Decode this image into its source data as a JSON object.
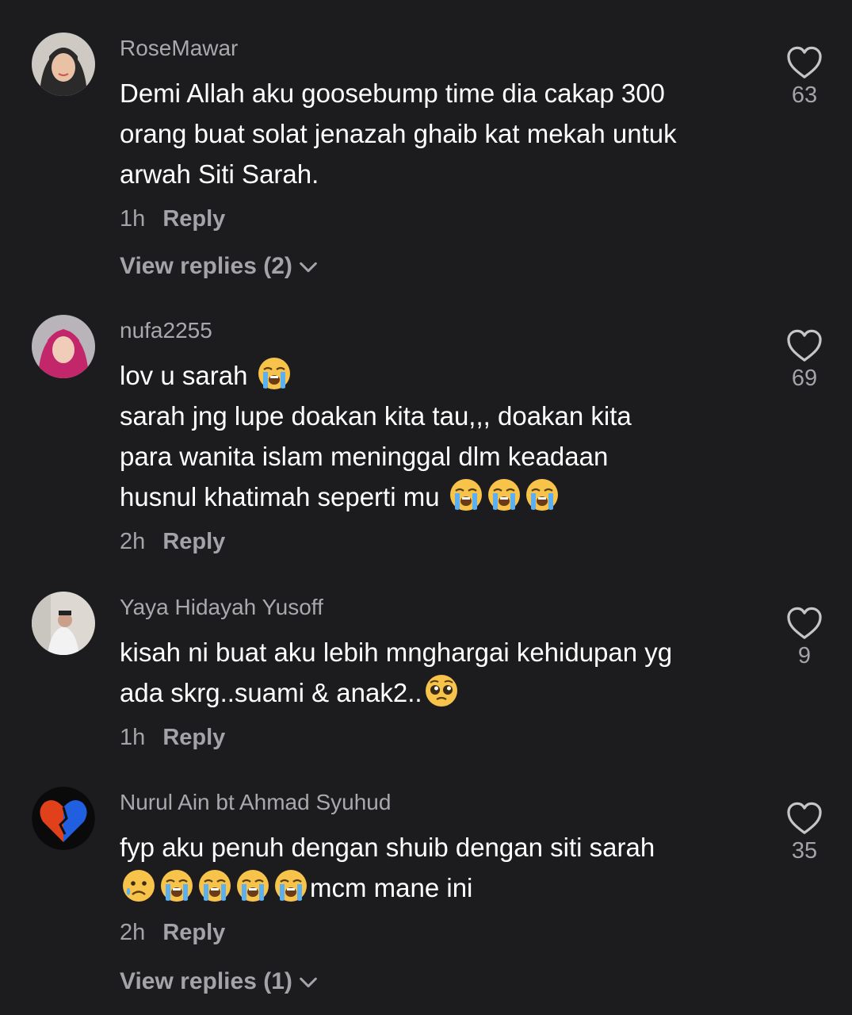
{
  "comments": [
    {
      "username": "RoseMawar",
      "lines": [
        "Demi Allah aku goosebump time dia cakap 300",
        "orang buat solat jenazah ghaib kat mekah untuk",
        "arwah Siti Sarah."
      ],
      "time": "1h",
      "reply_label": "Reply",
      "likes": "63",
      "view_replies": "View replies (2)"
    },
    {
      "username": "nufa2255",
      "lines": [
        "lov u sarah",
        "sarah jng lupe doakan kita tau,,, doakan kita",
        "para wanita islam meninggal dlm keadaan",
        "husnul khatimah seperti mu"
      ],
      "time": "2h",
      "reply_label": "Reply",
      "likes": "69"
    },
    {
      "username": "Yaya Hidayah Yusoff",
      "lines": [
        "kisah ni buat aku lebih mnghargai kehidupan yg",
        "ada skrg..suami & anak2.."
      ],
      "time": "1h",
      "reply_label": "Reply",
      "likes": "9"
    },
    {
      "username": "Nurul Ain bt Ahmad Syuhud",
      "lines": [
        "fyp aku penuh dengan shuib dengan siti sarah",
        "mcm mane ini"
      ],
      "time": "2h",
      "reply_label": "Reply",
      "likes": "35",
      "view_replies": "View replies (1)"
    }
  ],
  "icons": {
    "like": "heart-outline-icon",
    "expand": "chevron-down-icon",
    "emoji_cry": "loudly-crying-face",
    "emoji_plead": "pleading-face",
    "emoji_sad": "crying-face"
  },
  "colors": {
    "background": "#1c1c1e",
    "secondary_text": "#a3a3a8"
  }
}
